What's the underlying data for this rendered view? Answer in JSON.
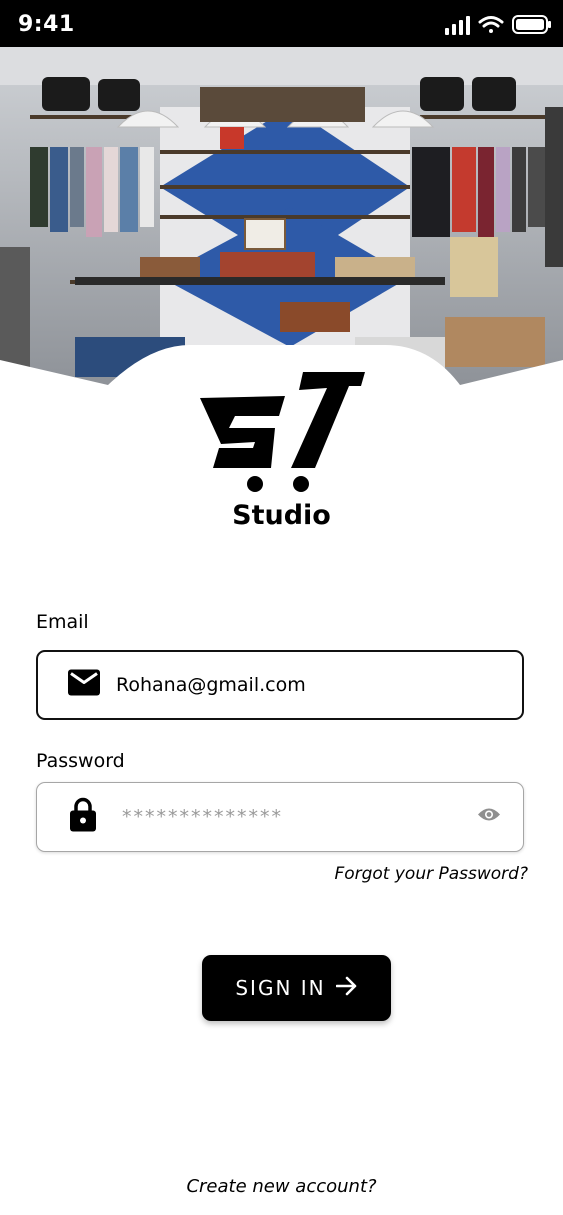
{
  "status_bar": {
    "time": "9:41"
  },
  "brand": {
    "name": "Studio"
  },
  "email": {
    "label": "Email",
    "value": "Rohana@gmail.com",
    "icon": "mail-icon"
  },
  "password": {
    "label": "Password",
    "placeholder": "**************",
    "icon": "lock-icon",
    "toggle_icon": "eye-icon"
  },
  "links": {
    "forgot": "Forgot your Password?",
    "create": "Create new account?"
  },
  "signin": {
    "label": "SIGN IN"
  },
  "colors": {
    "primary": "#000000",
    "background": "#ffffff",
    "placeholder": "#9a9a9a"
  }
}
